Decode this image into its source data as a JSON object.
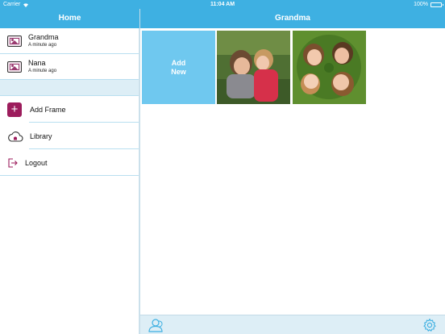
{
  "status_bar": {
    "carrier": "Carrier",
    "time": "11:04 AM",
    "battery": "100%"
  },
  "sidebar": {
    "title": "Home",
    "frames": [
      {
        "name": "Grandma",
        "subtitle": "A minute ago",
        "icon": "photo-icon"
      },
      {
        "name": "Nana",
        "subtitle": "A minute ago",
        "icon": "photo-icon"
      }
    ],
    "menu": [
      {
        "label": "Add Frame",
        "icon": "plus-icon"
      },
      {
        "label": "Library",
        "icon": "cloud-icon"
      },
      {
        "label": "Logout",
        "icon": "logout-icon"
      }
    ]
  },
  "main": {
    "title": "Grandma",
    "add_tile_label": "Add\nNew",
    "photos": [
      {
        "icon": "photo-thumbnail"
      },
      {
        "icon": "photo-thumbnail"
      }
    ]
  },
  "toolbar": {
    "left_icon": "user-icon",
    "right_icon": "gear-icon"
  },
  "colors": {
    "accent": "#3eb0e2",
    "add_tile": "#6fc8ef",
    "brand": "#9c1c5c",
    "separator": "#b9dff0",
    "band": "#ddeef6"
  }
}
